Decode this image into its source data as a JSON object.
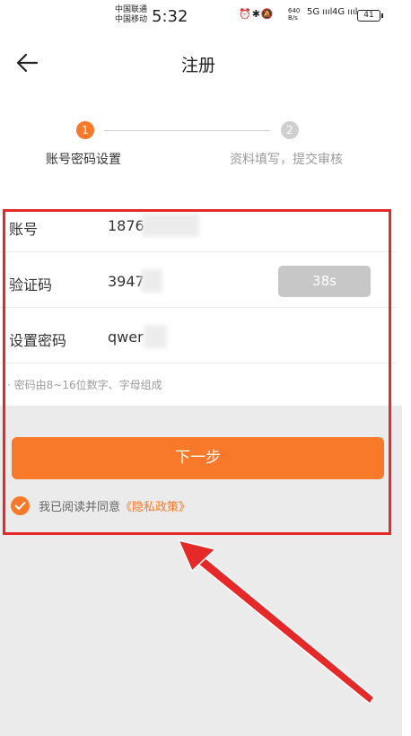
{
  "status_bar": {
    "carrier1": "中国联通",
    "carrier2": "中国移动",
    "time": "5:32",
    "icons_text": "⏰✱🔕",
    "speed_value": "640",
    "speed_unit": "B/s",
    "signal1": "5G ıııl",
    "signal2": "4G ıııl",
    "battery": "41"
  },
  "header": {
    "title": "注册"
  },
  "steps": [
    {
      "number": "1",
      "label": "账号密码设置",
      "active": true
    },
    {
      "number": "2",
      "label": "资料填写，提交审核",
      "active": false
    }
  ],
  "form": {
    "account_label": "账号",
    "account_value": "1876",
    "code_label": "验证码",
    "code_value": "3947",
    "code_button": "38s",
    "password_label": "设置密码",
    "password_value": "qwer",
    "hint": "· 密码由8~16位数字、字母组成"
  },
  "next_button": "下一步",
  "agreement": {
    "text": "我已阅读并同意",
    "link": "《隐私政策》"
  },
  "colors": {
    "accent": "#f8792a",
    "annotation": "#e52828",
    "disabled": "#c7c7c7"
  },
  "icons": [
    "back-arrow-icon",
    "check-icon",
    "alarm-icon",
    "bluetooth-icon",
    "mute-icon",
    "battery-icon"
  ]
}
